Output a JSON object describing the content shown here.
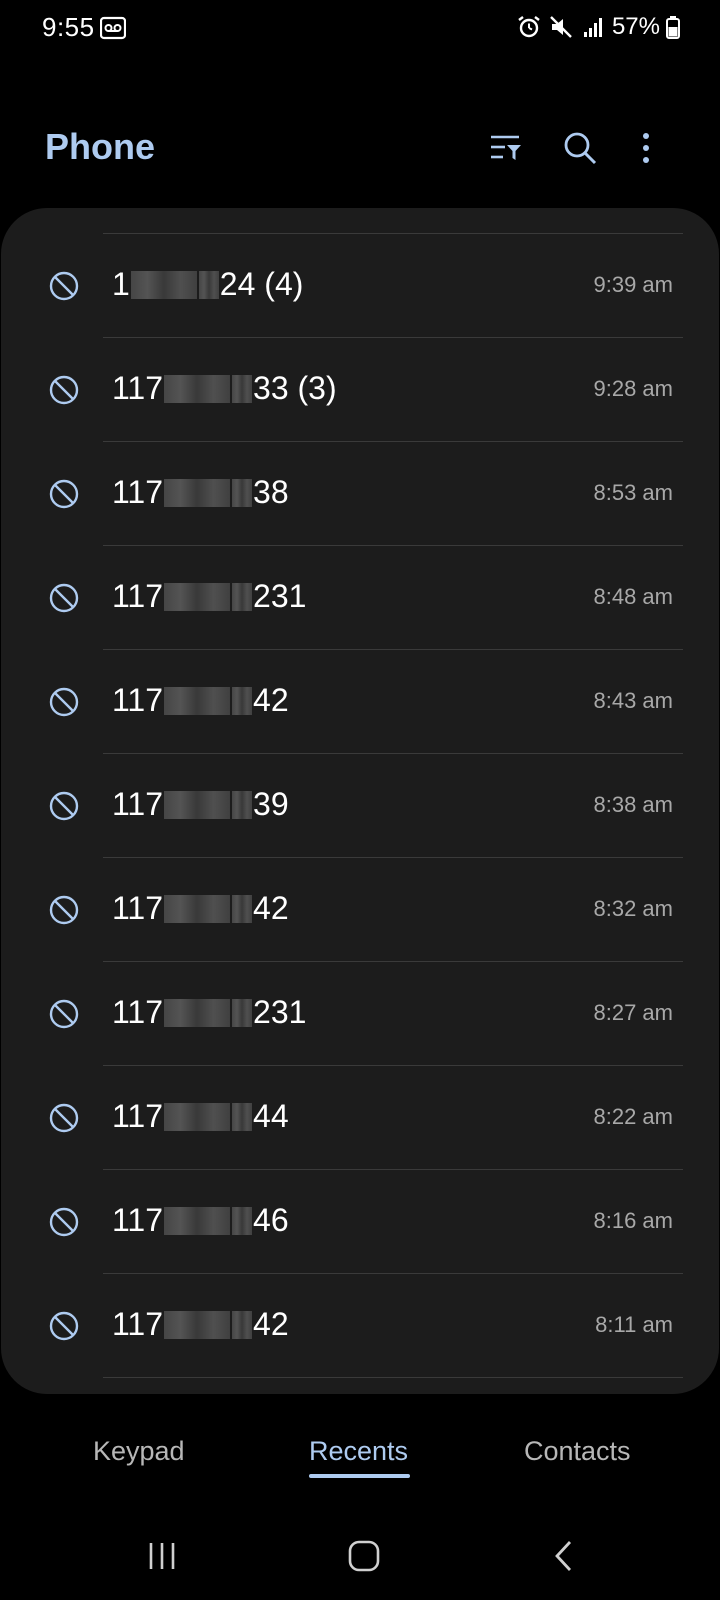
{
  "status_bar": {
    "time": "9:55",
    "battery": "57%"
  },
  "header": {
    "title": "Phone",
    "title_color": "#aecbf0",
    "icons": [
      "filter-icon",
      "search-icon",
      "more-options-icon"
    ]
  },
  "calls": [
    {
      "prefix": "1",
      "suffix": "24 (4)",
      "time": "9:39 am"
    },
    {
      "prefix": "117",
      "suffix": "33 (3)",
      "time": "9:28 am"
    },
    {
      "prefix": "117",
      "suffix": "38",
      "time": "8:53 am"
    },
    {
      "prefix": "117",
      "suffix": "231",
      "time": "8:48 am"
    },
    {
      "prefix": "117",
      "suffix": "42",
      "time": "8:43 am"
    },
    {
      "prefix": "117",
      "suffix": "39",
      "time": "8:38 am"
    },
    {
      "prefix": "117",
      "suffix": "42",
      "time": "8:32 am"
    },
    {
      "prefix": "117",
      "suffix": "231",
      "time": "8:27 am"
    },
    {
      "prefix": "117",
      "suffix": "44",
      "time": "8:22 am"
    },
    {
      "prefix": "117",
      "suffix": "46",
      "time": "8:16 am"
    },
    {
      "prefix": "117",
      "suffix": "42",
      "time": "8:11 am"
    }
  ],
  "tabs": [
    {
      "label": "Keypad",
      "active": false
    },
    {
      "label": "Recents",
      "active": true
    },
    {
      "label": "Contacts",
      "active": false
    }
  ],
  "colors": {
    "accent": "#aecbf0",
    "card_bg": "#1c1c1c",
    "page_bg": "#000000"
  }
}
